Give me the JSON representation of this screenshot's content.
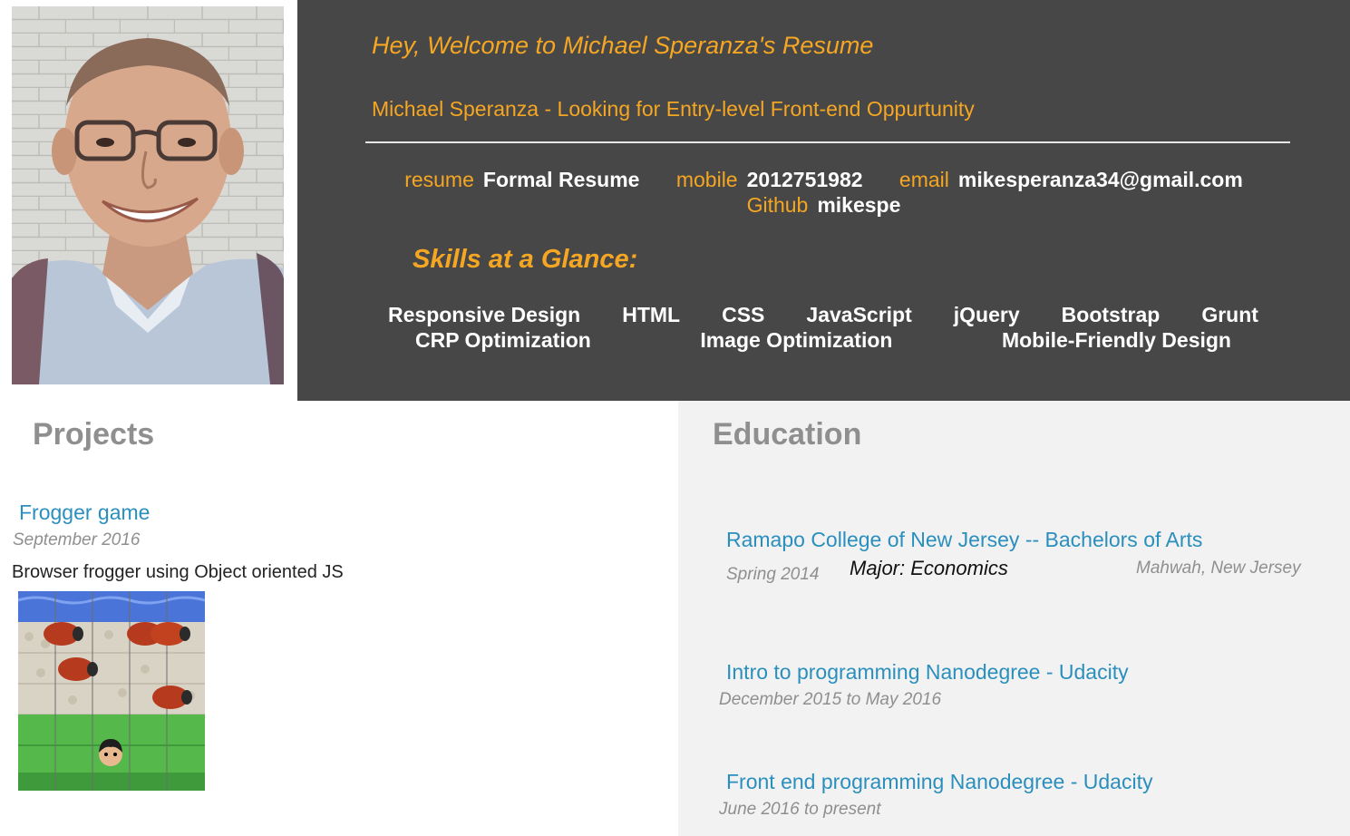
{
  "header": {
    "welcome": "Hey, Welcome to Michael Speranza's Resume",
    "tagline": "Michael Speranza - Looking for Entry-level Front-end Oppurtunity",
    "contacts": [
      {
        "label": "resume",
        "value": "Formal Resume"
      },
      {
        "label": "mobile",
        "value": "2012751982"
      },
      {
        "label": "email",
        "value": "mikesperanza34@gmail.com"
      },
      {
        "label": "Github",
        "value": "mikespe"
      }
    ],
    "skills_title": "Skills at a Glance:",
    "skills": [
      "Responsive Design",
      "HTML",
      "CSS",
      "JavaScript",
      "jQuery",
      "Bootstrap",
      "Grunt",
      "CRP Optimization",
      "Image Optimization",
      "Mobile-Friendly Design"
    ]
  },
  "projects": {
    "title": "Projects",
    "items": [
      {
        "name": "Frogger game",
        "date": "September 2016",
        "description": "Browser frogger using Object oriented JS"
      }
    ]
  },
  "education": {
    "title": "Education",
    "items": [
      {
        "name": "Ramapo College of New Jersey -- Bachelors of Arts",
        "date": "Spring 2014",
        "major": "Major: Economics",
        "location": "Mahwah, New Jersey"
      },
      {
        "name": "Intro to programming Nanodegree - Udacity",
        "date": "December 2015 to May 2016"
      },
      {
        "name": "Front end programming Nanodegree - Udacity",
        "date": "June 2016 to present"
      }
    ]
  },
  "colors": {
    "accent": "#f5a623",
    "header_bg": "#474747",
    "link": "#2a8fbd",
    "muted": "#8f8f8f",
    "education_bg": "#f2f2f2"
  },
  "icons": {
    "photo": "profile-photo",
    "game": "frogger-game-screenshot"
  }
}
